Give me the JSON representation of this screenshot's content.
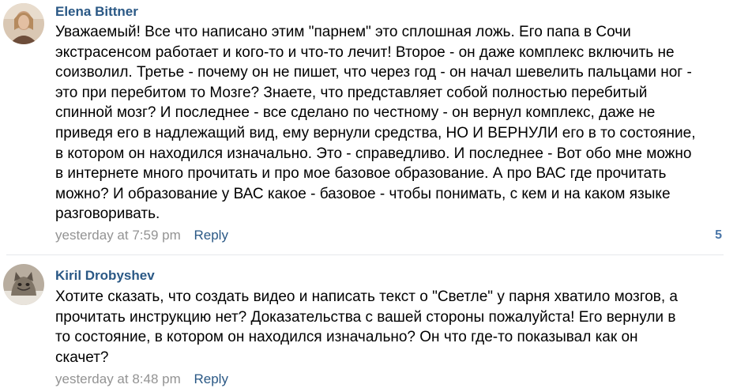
{
  "comments": [
    {
      "author": "Elena Bittner",
      "text": "Уважаемый! Все что написано этим \"парнем\" это сплошная ложь. Его папа в Сочи\nэкстрасенсом работает и кого-то и что-то лечит! Второе - он даже комплекс включить не\nсоизволил. Третье - почему он не пишет, что через год - он начал шевелить пальцами ног -\nэто при перебитом то Мозге? Знаете, что представляет собой полностью перебитый\nспинной мозг? И последнее - все сделано по честному - он вернул комплекс, даже не\nприведя его в надлежащий вид, ему вернули средства, НО И ВЕРНУЛИ его в то состояние,\nв котором он находился изначально. Это - справедливо. И последнее - Вот обо мне можно\nв интернете много прочитать и про мое базовое образование. А про ВАС где прочитать\nможно? И образование у ВАС какое - базовое - чтобы понимать, с кем и на каком языке\nразговоривать.",
      "time": "yesterday at 7:59 pm",
      "reply_label": "Reply",
      "likes": "5",
      "avatar_icon": "user-photo-icon",
      "avatar_colors": [
        "#c8a98a",
        "#7a5c48",
        "#e6d6c4"
      ]
    },
    {
      "author": "Kiril Drobyshev",
      "text": "Хотите сказать, что создать видео и написать текст о \"Светле\" у парня хватило мозгов, а\nпрочитать инструкцию нет? Доказательства с вашей стороны пожалуйста! Его вернули в\nто состояние, в котором он находился изначально? Он что где-то показывал как он\nскачет?",
      "time": "yesterday at 8:48 pm",
      "reply_label": "Reply",
      "avatar_icon": "cat-photo-icon",
      "avatar_colors": [
        "#9a9185",
        "#c9bfb0",
        "#3b3430"
      ]
    }
  ],
  "colors": {
    "author": "#2a5885",
    "meta": "#939393",
    "reply": "#2a5885",
    "likes": "#4a76a8",
    "divider": "#e7e8ec"
  }
}
